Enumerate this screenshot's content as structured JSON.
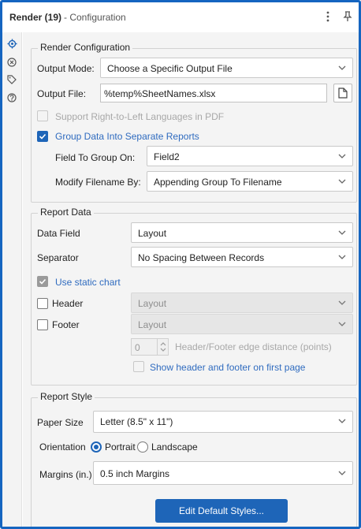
{
  "title": {
    "tool": "Render (19)",
    "section": "- Configuration"
  },
  "colors": {
    "accent": "#1e65b8",
    "frame": "#1565c0"
  },
  "titlebar_icons": [
    "more-vert-icon",
    "pin-icon"
  ],
  "sidebar_icons": [
    "gear-icon",
    "close-circle-icon",
    "tag-icon",
    "help-icon"
  ],
  "render_config": {
    "legend": "Render Configuration",
    "output_mode": {
      "label": "Output Mode:",
      "value": "Choose a Specific Output File"
    },
    "output_file": {
      "label": "Output File:",
      "value": "%temp%SheetNames.xlsx"
    },
    "rtl": {
      "label": "Support Right-to-Left Languages in PDF",
      "checked": false,
      "enabled": false
    },
    "group_data": {
      "label": "Group Data Into Separate Reports",
      "checked": true
    },
    "field_to_group": {
      "label": "Field To Group On:",
      "value": "Field2"
    },
    "modify_filename": {
      "label": "Modify Filename By:",
      "value": "Appending Group To Filename"
    }
  },
  "report_data": {
    "legend": "Report Data",
    "data_field": {
      "label": "Data Field",
      "value": "Layout"
    },
    "separator": {
      "label": "Separator",
      "value": "No Spacing Between Records"
    },
    "static_chart": {
      "label": "Use static chart",
      "checked": true,
      "enabled": false
    },
    "header": {
      "label": "Header",
      "checked": false,
      "value": "Layout"
    },
    "footer": {
      "label": "Footer",
      "checked": false,
      "value": "Layout"
    },
    "edge_distance": {
      "value": "0",
      "label": "Header/Footer edge distance (points)"
    },
    "first_page": {
      "label": "Show header and footer on first page",
      "checked": false
    }
  },
  "report_style": {
    "legend": "Report Style",
    "paper_size": {
      "label": "Paper Size",
      "value": "Letter (8.5\" x 11\")"
    },
    "orientation": {
      "label": "Orientation",
      "portrait": "Portrait",
      "landscape": "Landscape",
      "selected": "Portrait"
    },
    "margins": {
      "label": "Margins (in.)",
      "value": "0.5 inch Margins"
    },
    "edit_button": "Edit Default Styles..."
  }
}
